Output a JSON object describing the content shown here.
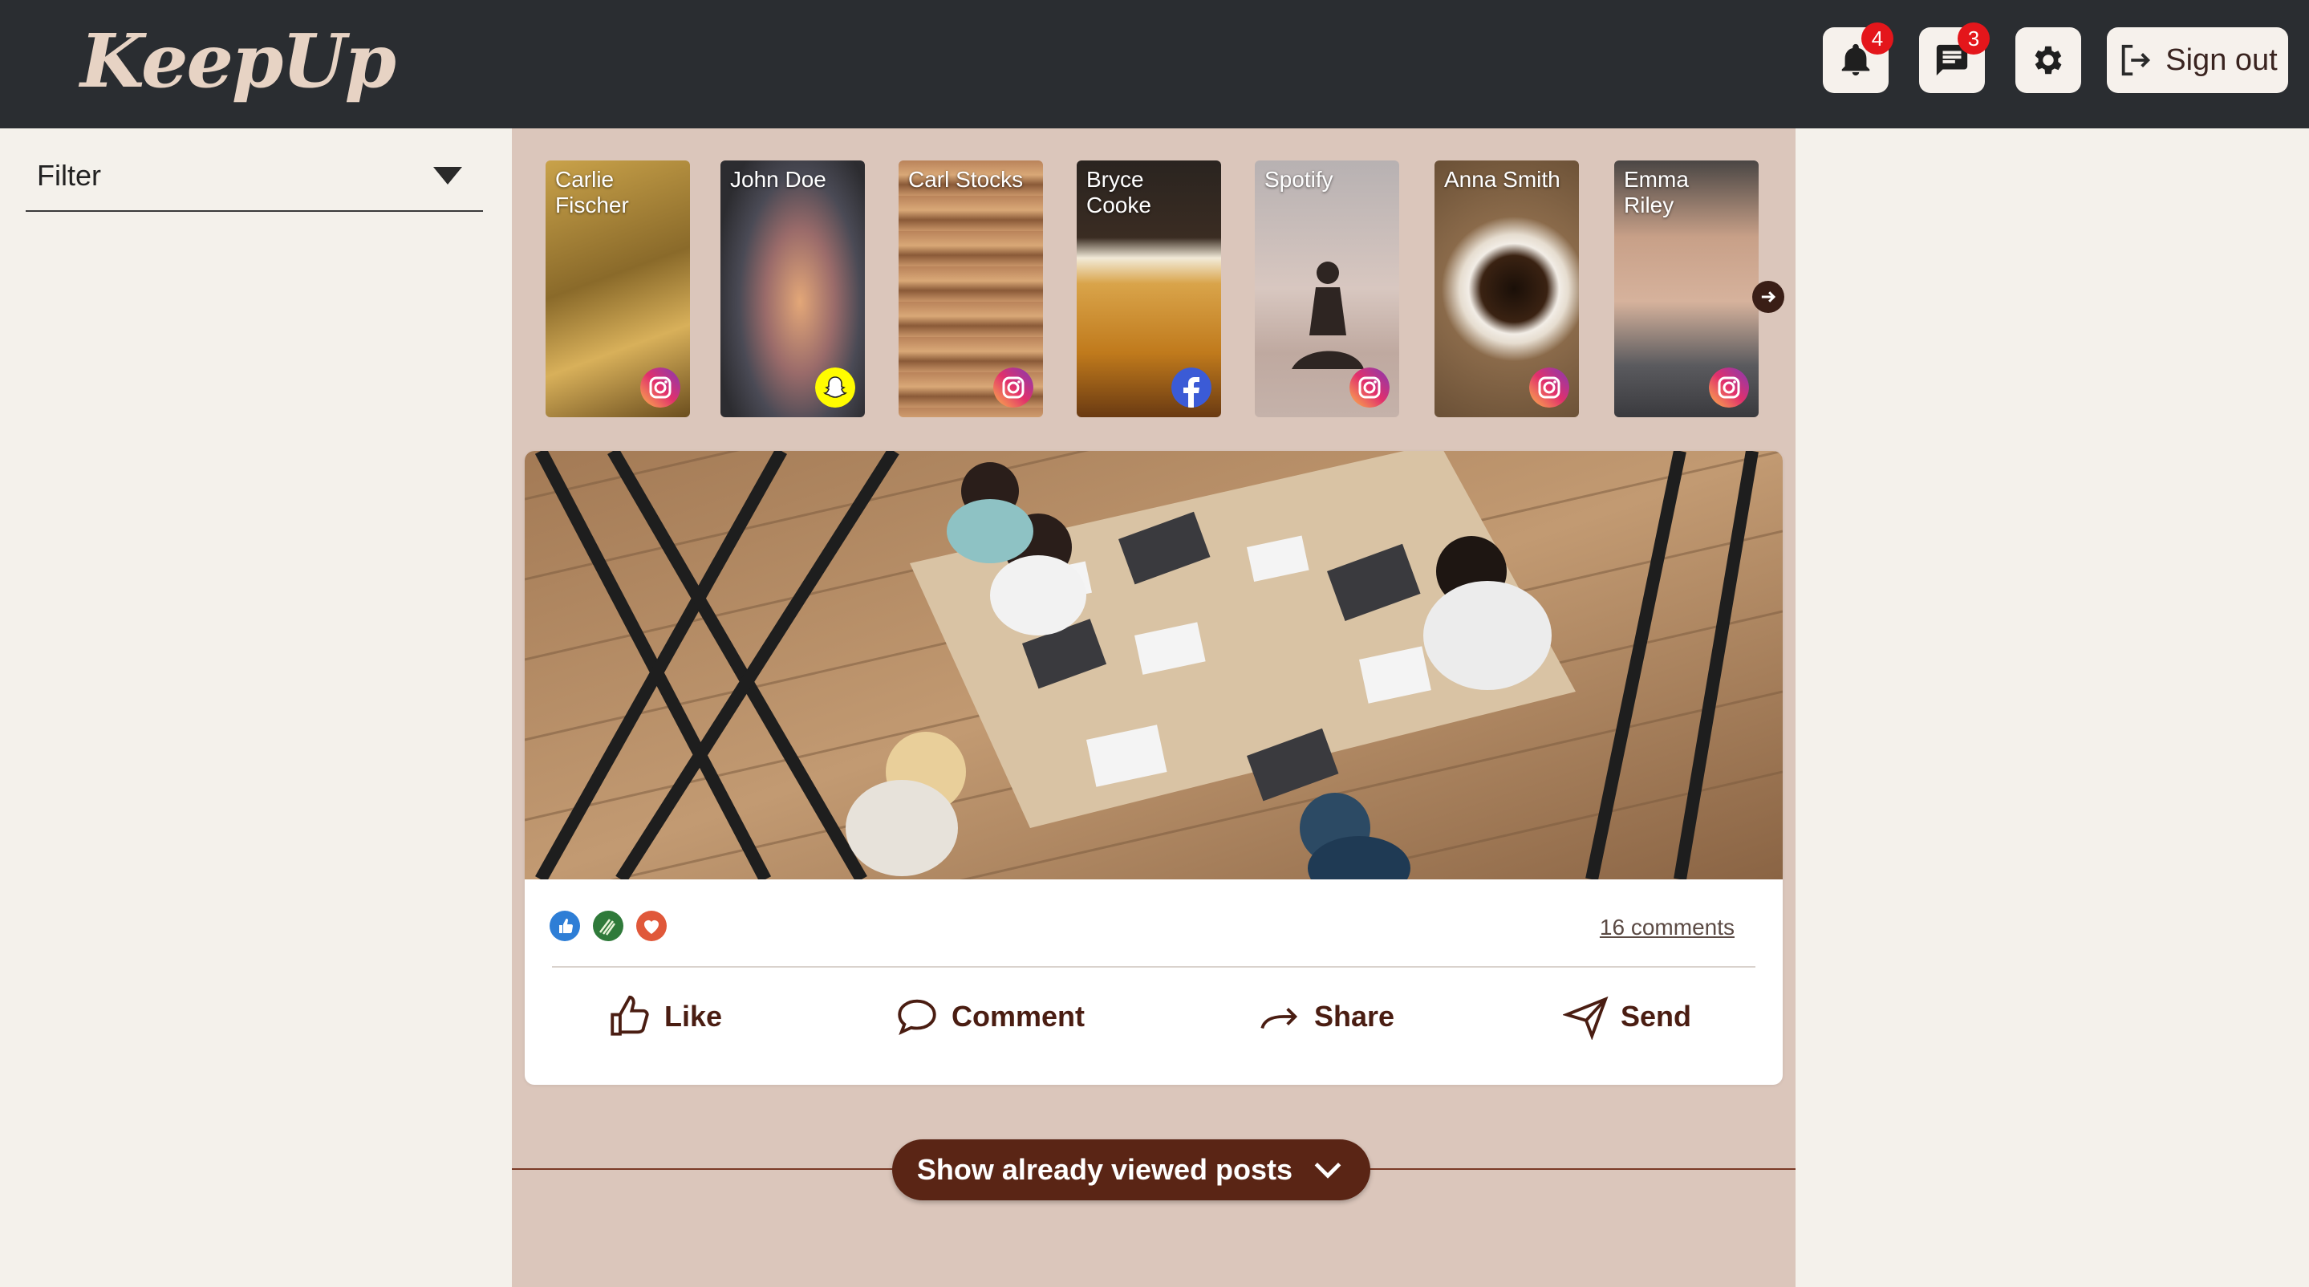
{
  "app": {
    "logo": "KeepUp"
  },
  "header": {
    "notifications_count": "4",
    "messages_count": "3",
    "signout_label": "Sign out"
  },
  "sidebar": {
    "filter_label": "Filter"
  },
  "stories": [
    {
      "name": "Carlie Fischer",
      "network": "instagram"
    },
    {
      "name": "John Doe",
      "network": "snapchat"
    },
    {
      "name": "Carl Stocks",
      "network": "instagram"
    },
    {
      "name": "Bryce Cooke",
      "network": "facebook"
    },
    {
      "name": "Spotify",
      "network": "instagram"
    },
    {
      "name": "Anna Smith",
      "network": "instagram"
    },
    {
      "name": "Emma Riley",
      "network": "instagram"
    }
  ],
  "post": {
    "reactions": [
      "like",
      "clap",
      "love"
    ],
    "comments_label": "16 comments",
    "actions": {
      "like": "Like",
      "comment": "Comment",
      "share": "Share",
      "send": "Send"
    }
  },
  "feed": {
    "show_viewed_label": "Show already viewed posts"
  },
  "colors": {
    "header_bg": "#2a2d31",
    "feed_bg": "#dbc6bb",
    "accent": "#5a2515",
    "badge": "#e4161b"
  }
}
